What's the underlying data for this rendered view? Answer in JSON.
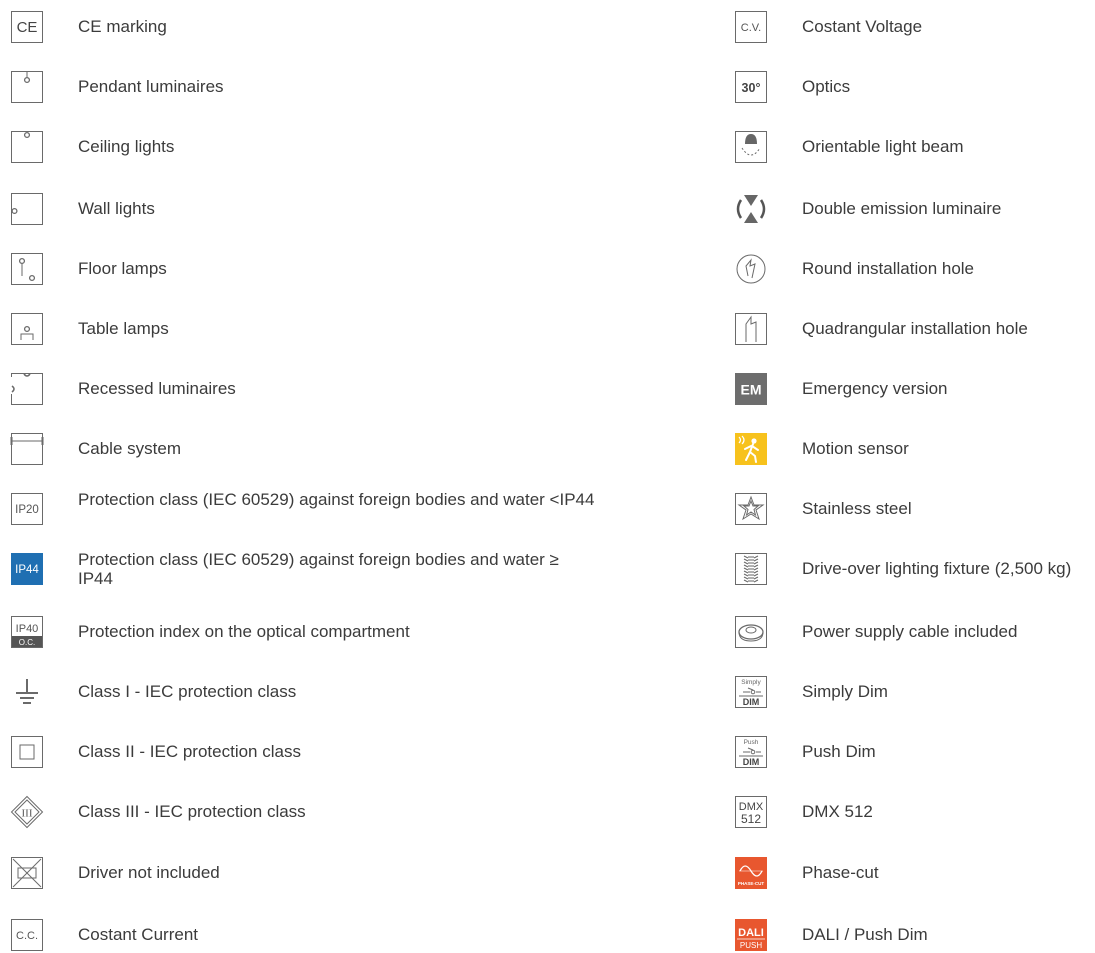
{
  "left": [
    {
      "icon": "ce-marking-icon",
      "label": "CE marking",
      "glyph": "CE"
    },
    {
      "icon": "pendant-luminaire-icon",
      "label": "Pendant luminaires"
    },
    {
      "icon": "ceiling-light-icon",
      "label": "Ceiling lights"
    },
    {
      "icon": "wall-light-icon",
      "label": "Wall lights"
    },
    {
      "icon": "floor-lamp-icon",
      "label": "Floor lamps"
    },
    {
      "icon": "table-lamp-icon",
      "label": "Table lamps"
    },
    {
      "icon": "recessed-luminaire-icon",
      "label": "Recessed luminaires"
    },
    {
      "icon": "cable-system-icon",
      "label": "Cable system"
    },
    {
      "icon": "ip20-icon",
      "label": "Protection class (IEC 60529) against foreign bodies and water <IP44",
      "glyph": "IP20"
    },
    {
      "icon": "ip44-icon",
      "label": "Protection class (IEC 60529) against foreign bodies and water ≥ IP44",
      "glyph": "IP44"
    },
    {
      "icon": "ip40-optical-compartment-icon",
      "label": "Protection index on the optical compartment",
      "glyph": "IP40",
      "glyph2": "O.C."
    },
    {
      "icon": "class-1-ground-icon",
      "label": "Class I - IEC protection class"
    },
    {
      "icon": "class-2-square-icon",
      "label": "Class II - IEC protection class"
    },
    {
      "icon": "class-3-diamond-icon",
      "label": "Class III - IEC protection class",
      "glyph": "III"
    },
    {
      "icon": "driver-not-included-icon",
      "label": "Driver not included"
    },
    {
      "icon": "constant-current-icon",
      "label": "Costant Current",
      "glyph": "C.C."
    }
  ],
  "right": [
    {
      "icon": "constant-voltage-icon",
      "label": "Costant Voltage",
      "glyph": "C.V."
    },
    {
      "icon": "optics-30-icon",
      "label": "Optics",
      "glyph": "30°"
    },
    {
      "icon": "orientable-beam-icon",
      "label": "Orientable light beam"
    },
    {
      "icon": "double-emission-icon",
      "label": "Double emission luminaire"
    },
    {
      "icon": "round-hole-icon",
      "label": "Round installation hole"
    },
    {
      "icon": "quadrangular-hole-icon",
      "label": "Quadrangular installation hole"
    },
    {
      "icon": "emergency-em-icon",
      "label": "Emergency version",
      "glyph": "EM"
    },
    {
      "icon": "motion-sensor-icon",
      "label": "Motion sensor"
    },
    {
      "icon": "stainless-steel-star-icon",
      "label": "Stainless steel"
    },
    {
      "icon": "drive-over-tire-icon",
      "label": "Drive-over lighting fixture (2,500 kg)"
    },
    {
      "icon": "power-cable-icon",
      "label": "Power supply cable included"
    },
    {
      "icon": "simply-dim-icon",
      "label": "Simply Dim",
      "glyph": "Simply",
      "glyph2": "DIM"
    },
    {
      "icon": "push-dim-icon",
      "label": "Push Dim",
      "glyph": "Push",
      "glyph2": "DIM"
    },
    {
      "icon": "dmx-512-icon",
      "label": "DMX 512",
      "glyph": "DMX",
      "glyph2": "512"
    },
    {
      "icon": "phase-cut-icon",
      "label": "Phase-cut",
      "glyph": "PHASE-CUT"
    },
    {
      "icon": "dali-push-icon",
      "label": "DALI / Push Dim",
      "glyph": "DALI",
      "glyph2": "PUSH"
    }
  ],
  "colors": {
    "ip44_bg": "#1f6fb2",
    "em_bg": "#6d6d6d",
    "motion_bg": "#f7c21d",
    "phase_bg": "#e8572f",
    "dali_bg": "#e8572f",
    "icon_stroke": "#6a6a6a"
  }
}
